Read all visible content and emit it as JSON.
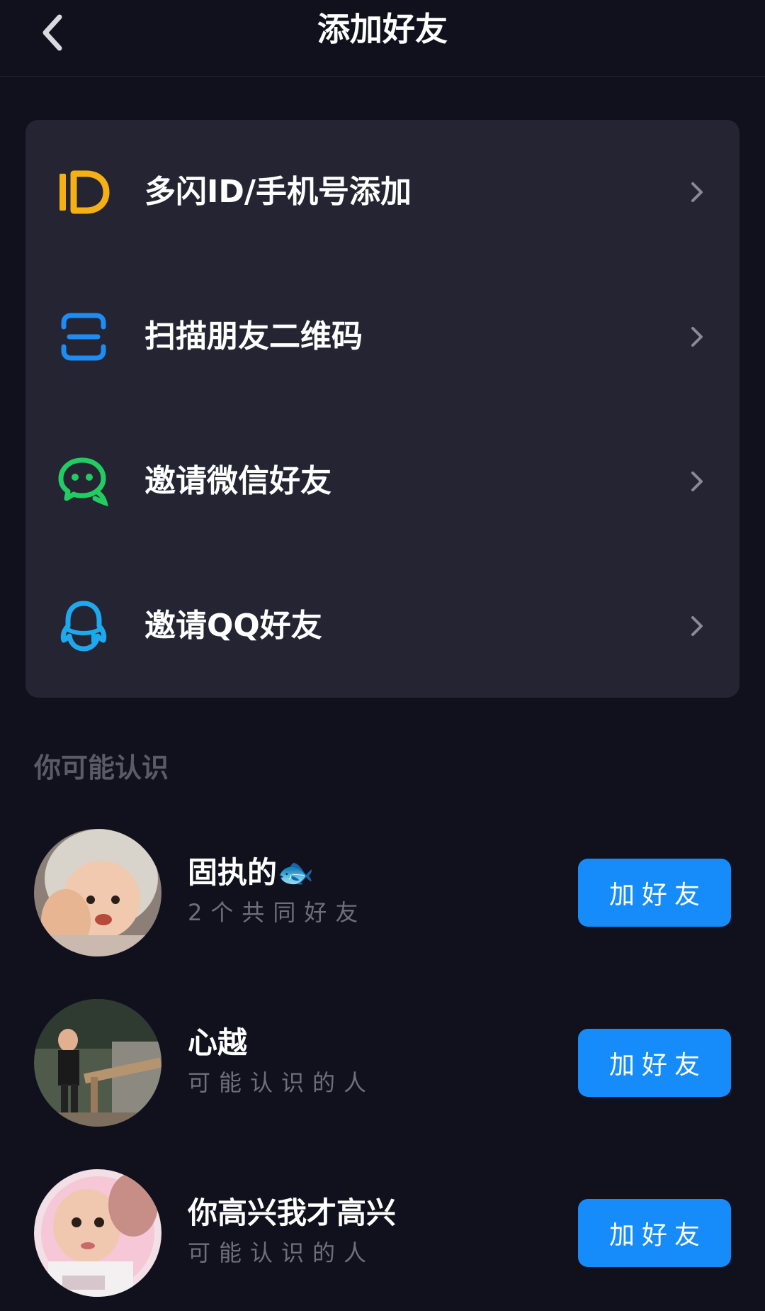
{
  "header": {
    "title": "添加好友"
  },
  "menu": {
    "items": [
      {
        "label": "多闪ID/手机号添加",
        "icon": "id-icon",
        "color": "#f5b013"
      },
      {
        "label": "扫描朋友二维码",
        "icon": "scan-qr-icon",
        "color": "#1e8cf5"
      },
      {
        "label": "邀请微信好友",
        "icon": "wechat-icon",
        "color": "#22cc60"
      },
      {
        "label": "邀请QQ好友",
        "icon": "qq-icon",
        "color": "#1ea8ee"
      }
    ]
  },
  "suggestions": {
    "title": "你可能认识",
    "button_label": "加好友",
    "items": [
      {
        "name": "固执的🐟",
        "subtitle": "2个共同好友"
      },
      {
        "name": "心越",
        "subtitle": "可能认识的人"
      },
      {
        "name": "你高兴我才高兴",
        "subtitle": "可能认识的人"
      }
    ]
  },
  "colors": {
    "background": "#11111d",
    "card": "#242433",
    "accent": "#168cfb"
  }
}
